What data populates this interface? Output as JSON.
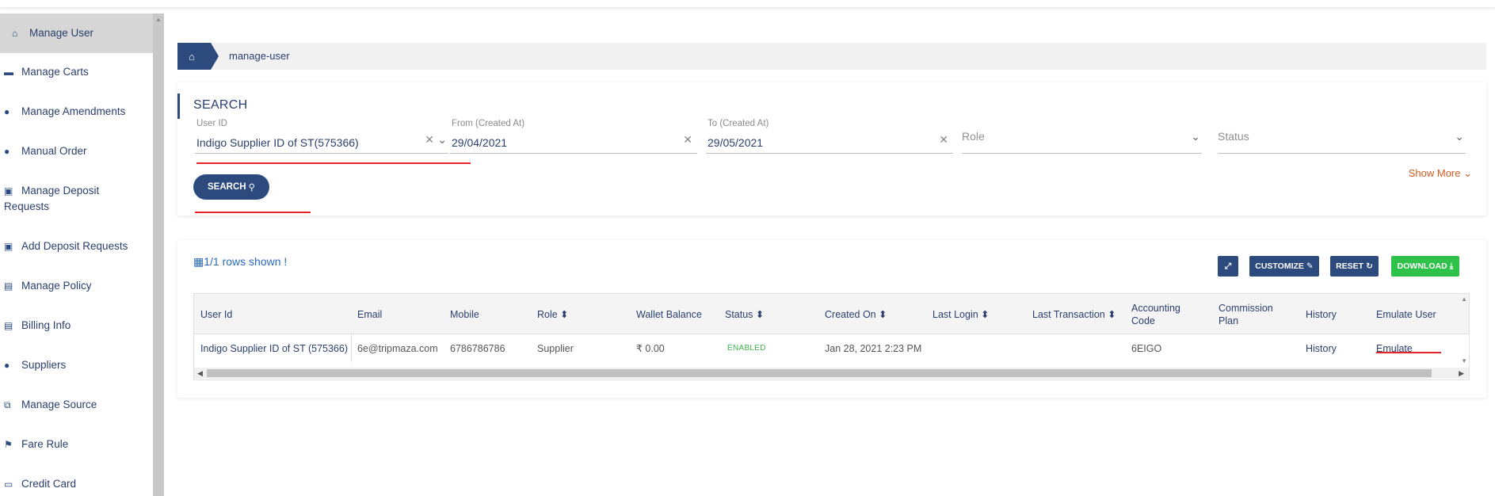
{
  "sidebar": {
    "items": [
      {
        "icon": "home-icon",
        "glyph": "⌂",
        "label": "Manage User"
      },
      {
        "icon": "cart-icon",
        "glyph": "🛒",
        "label": "Manage Carts"
      },
      {
        "icon": "users-icon",
        "glyph": "👥",
        "label": "Manage Amendments"
      },
      {
        "icon": "user-plus-icon",
        "glyph": "👤",
        "label": "Manual Order"
      },
      {
        "icon": "money-icon",
        "glyph": "▣",
        "label": "Manage Deposit Requests"
      },
      {
        "icon": "money-icon",
        "glyph": "▣",
        "label": "Add Deposit Requests"
      },
      {
        "icon": "file-icon",
        "glyph": "▤",
        "label": "Manage Policy"
      },
      {
        "icon": "file-icon",
        "glyph": "▤",
        "label": "Billing Info"
      },
      {
        "icon": "users-icon",
        "glyph": "👥",
        "label": "Suppliers"
      },
      {
        "icon": "cubes-icon",
        "glyph": "⧉",
        "label": "Manage Source"
      },
      {
        "icon": "flag-icon",
        "glyph": "⚑",
        "label": "Fare Rule"
      },
      {
        "icon": "credit-card-icon",
        "glyph": "▭",
        "label": "Credit Card"
      }
    ]
  },
  "breadcrumb": {
    "current": "manage-user"
  },
  "search": {
    "title": "SEARCH",
    "user_id": {
      "label": "User ID",
      "value": "Indigo Supplier ID of ST(575366)"
    },
    "from": {
      "label": "From (Created At)",
      "value": "29/04/2021"
    },
    "to": {
      "label": "To (Created At)",
      "value": "29/05/2021"
    },
    "role": {
      "placeholder": "Role"
    },
    "status": {
      "placeholder": "Status"
    },
    "show_more": "Show More ⌄",
    "button": "SEARCH"
  },
  "table": {
    "rows_shown": "1/1 rows shown !",
    "buttons": {
      "customize": "CUSTOMIZE",
      "reset": "RESET",
      "download": "DOWNLOAD"
    },
    "colors": {
      "primary": "#2c4a7e",
      "download": "#2ec24a",
      "enabled": "#3cb34b"
    },
    "headers": {
      "user_id": "User Id",
      "email": "Email",
      "mobile": "Mobile",
      "role": "Role ⬍",
      "wallet": "Wallet Balance",
      "status": "Status ⬍",
      "created": "Created On ⬍",
      "last_login": "Last Login ⬍",
      "last_txn": "Last Transaction ⬍",
      "accounting": "Accounting Code",
      "commission": "Commission Plan",
      "history": "History",
      "emulate": "Emulate User"
    },
    "row": {
      "user_id": "Indigo Supplier ID of ST (575366)",
      "email": "6e@tripmaza.com",
      "mobile": "6786786786",
      "role": "Supplier",
      "wallet": "₹ 0.00",
      "status": "ENABLED",
      "created": "Jan 28, 2021 2:23 PM",
      "accounting": "6EIGO",
      "history": "History",
      "emulate": "Emulate"
    }
  }
}
